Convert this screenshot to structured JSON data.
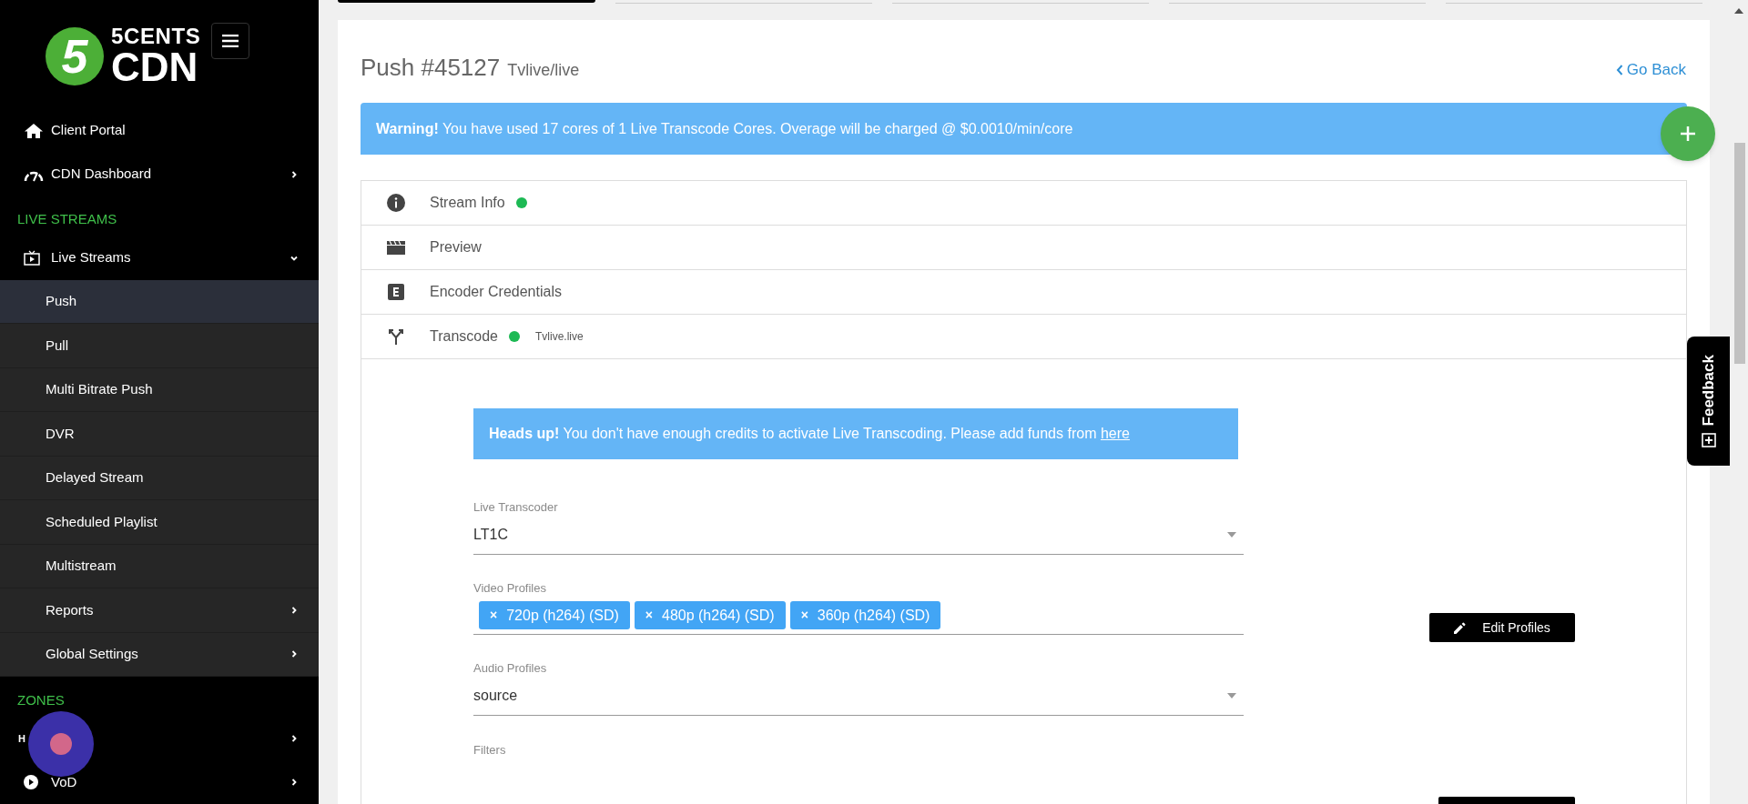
{
  "logo": {
    "mark": "5",
    "line1": "5CENTS",
    "line2": "CDN"
  },
  "sidebar": {
    "items": [
      {
        "kind": "link",
        "label": "Client Portal"
      },
      {
        "kind": "link",
        "label": "CDN Dashboard",
        "expanded": false
      },
      {
        "kind": "heading",
        "label": "LIVE STREAMS"
      },
      {
        "kind": "link",
        "label": "Live Streams",
        "expanded": true
      },
      {
        "kind": "subitem",
        "label": "Push",
        "selected": true
      },
      {
        "kind": "subitem",
        "label": "Pull",
        "selected": false
      },
      {
        "kind": "subitem",
        "label": "Multi Bitrate Push",
        "selected": false
      },
      {
        "kind": "subitem",
        "label": "DVR",
        "selected": false
      },
      {
        "kind": "subitem",
        "label": "Delayed Stream",
        "selected": false
      },
      {
        "kind": "subitem",
        "label": "Scheduled Playlist",
        "selected": false
      },
      {
        "kind": "subitem",
        "label": "Multistream",
        "selected": false
      },
      {
        "kind": "subitem",
        "label": "Reports",
        "selected": false,
        "expanded": false
      },
      {
        "kind": "subitem",
        "label": "Global Settings",
        "selected": false,
        "expanded": false
      },
      {
        "kind": "heading",
        "label": "ZONES"
      },
      {
        "kind": "link",
        "label": "H",
        "expanded": false
      },
      {
        "kind": "link",
        "label": "VoD",
        "expanded": false
      }
    ]
  },
  "page": {
    "title": "Push #45127",
    "subtitle": "Tvlive/live",
    "back_link": "Go Back"
  },
  "warning": "**Warning!** You have used 17 cores of 1 Live Transcode Cores. Overage will be charged @ $0.0010/min/core",
  "sections": [
    {
      "label": "Stream Info",
      "online": true
    },
    {
      "label": "Preview",
      "online": false
    },
    {
      "label": "Encoder Credentials",
      "online": false
    },
    {
      "label": "Transcode",
      "online": true,
      "note": "Tvlive.live"
    }
  ],
  "transcode": {
    "notice": "**Heads up!** You don't have enough credits to activate Live Transcoding. Please add funds from ",
    "notice_link": "here",
    "live_transcoder": {
      "label": "Live Transcoder",
      "value": "LT1C"
    },
    "video_profiles": {
      "label": "Video Profiles",
      "chips": [
        {
          "remove": "×",
          "label": "720p (h264) (SD)"
        },
        {
          "remove": "×",
          "label": "480p (h264) (SD)"
        },
        {
          "remove": "×",
          "label": "360p (h264) (SD)"
        }
      ]
    },
    "edit_profiles": "Edit Profiles",
    "audio_profiles": {
      "label": "Audio Profiles",
      "value": "source"
    },
    "filters": {
      "label": "Filters"
    }
  },
  "feedback": "Feedback"
}
